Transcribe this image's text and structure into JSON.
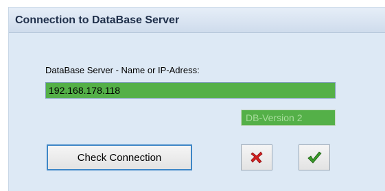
{
  "dialog": {
    "title": "Connection to DataBase Server"
  },
  "server": {
    "label": "DataBase Server  - Name or IP-Adress:",
    "value": "192.168.178.118"
  },
  "db_version": "DB-Version 2",
  "buttons": {
    "check_label": "Check Connection",
    "cancel_icon": "red-x-cross-icon",
    "ok_icon": "green-checkmark-icon"
  },
  "colors": {
    "field_green": "#54b048",
    "dialog_bg": "#dde9f5",
    "cancel_red": "#d42020",
    "ok_green": "#3a9a2a",
    "button_focus": "#3d86c6"
  }
}
